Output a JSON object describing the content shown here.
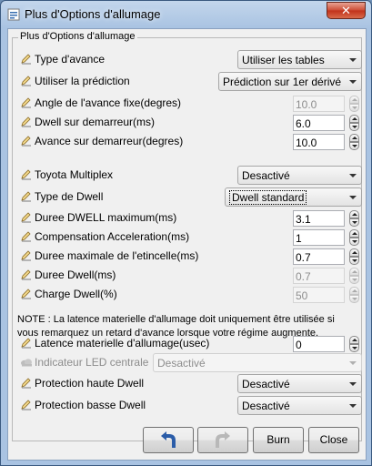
{
  "window": {
    "title": "Plus d'Options d'allumage",
    "close_glyph": "✕"
  },
  "group": {
    "legend": "Plus d'Options d'allumage"
  },
  "rows": [
    {
      "label": "Type d'avance",
      "type": "combo",
      "value": "Utiliser les tables",
      "enabled": true
    },
    {
      "label": "Utiliser la prédiction",
      "type": "combo",
      "value": "Prédiction sur 1er dérivé",
      "enabled": true
    },
    {
      "label": "Angle de l'avance fixe(degres)",
      "type": "spin",
      "value": "10.0",
      "enabled": false
    },
    {
      "label": "Dwell sur demarreur(ms)",
      "type": "spin",
      "value": "6.0",
      "enabled": true
    },
    {
      "label": "Avance sur demarreur(degres)",
      "type": "spin",
      "value": "10.0",
      "enabled": true
    },
    {
      "label": "Toyota Multiplex",
      "type": "combo",
      "value": "Desactivé",
      "enabled": true
    },
    {
      "label": "Type de Dwell",
      "type": "combo",
      "value": "Dwell standard",
      "enabled": true
    },
    {
      "label": "Duree DWELL maximum(ms)",
      "type": "spin",
      "value": "3.1",
      "enabled": true
    },
    {
      "label": "Compensation Acceleration(ms)",
      "type": "spin",
      "value": "1",
      "enabled": true
    },
    {
      "label": "Duree maximale de l'etincelle(ms)",
      "type": "spin",
      "value": "0.7",
      "enabled": true
    },
    {
      "label": "Duree Dwell(ms)",
      "type": "spin",
      "value": "0.7",
      "enabled": false
    },
    {
      "label": "Charge Dwell(%)",
      "type": "spin",
      "value": "50",
      "enabled": false
    },
    {
      "label": "Latence materielle d'allumage(usec)",
      "type": "spin",
      "value": "0",
      "enabled": true
    },
    {
      "label": "Indicateur LED centrale",
      "type": "combo",
      "value": "Desactivé",
      "enabled": false
    },
    {
      "label": "Protection haute Dwell",
      "type": "combo",
      "value": "Desactivé",
      "enabled": true
    },
    {
      "label": "Protection basse Dwell",
      "type": "combo",
      "value": "Desactivé",
      "enabled": true
    }
  ],
  "note": "NOTE : La latence materielle d'allumage doit uniquement être utilisée si vous remarquez un retard d'avance lorsque votre régime augmente.",
  "buttons": {
    "burn": "Burn",
    "close": "Close"
  },
  "icons": {
    "undo": "undo-icon",
    "redo": "redo-icon",
    "row_edit": "pencil-icon",
    "row_disabled": "cloud-icon"
  },
  "colors": {
    "title_bar": "#a9c3e2",
    "close_button": "#c1311a",
    "undo_arrow": "#2a5ca8",
    "panel_bg": "#f0f0f0"
  }
}
